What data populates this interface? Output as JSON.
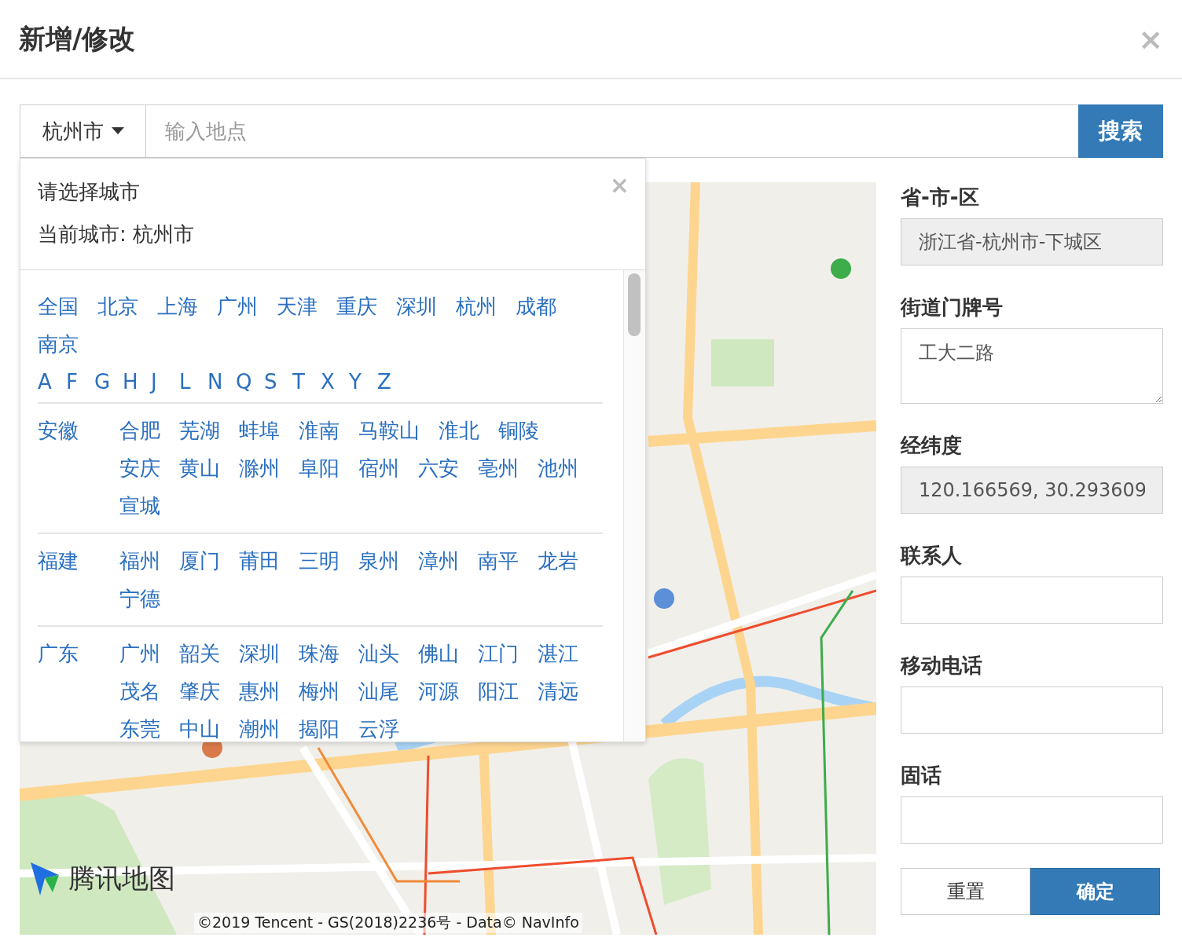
{
  "dialog": {
    "title": "新增/修改",
    "close": "×"
  },
  "search": {
    "city": "杭州市",
    "placeholder": "输入地点",
    "button": "搜索"
  },
  "city_picker": {
    "title": "请选择城市",
    "close": "×",
    "current": "当前城市: 杭州市",
    "hot_cities": [
      "全国",
      "北京",
      "上海",
      "广州",
      "天津",
      "重庆",
      "深圳",
      "杭州",
      "成都",
      "南京"
    ],
    "letters": [
      "A",
      "F",
      "G",
      "H",
      "J",
      "L",
      "N",
      "Q",
      "S",
      "T",
      "X",
      "Y",
      "Z"
    ],
    "provinces": [
      {
        "name": "安徽",
        "cities": [
          "合肥",
          "芜湖",
          "蚌埠",
          "淮南",
          "马鞍山",
          "淮北",
          "铜陵",
          "安庆",
          "黄山",
          "滁州",
          "阜阳",
          "宿州",
          "六安",
          "亳州",
          "池州",
          "宣城"
        ]
      },
      {
        "name": "福建",
        "cities": [
          "福州",
          "厦门",
          "莆田",
          "三明",
          "泉州",
          "漳州",
          "南平",
          "龙岩",
          "宁德"
        ]
      },
      {
        "name": "广东",
        "cities": [
          "广州",
          "韶关",
          "深圳",
          "珠海",
          "汕头",
          "佛山",
          "江门",
          "湛江",
          "茂名",
          "肇庆",
          "惠州",
          "梅州",
          "汕尾",
          "河源",
          "阳江",
          "清远",
          "东莞",
          "中山",
          "潮州",
          "揭阳",
          "云浮"
        ]
      }
    ]
  },
  "map": {
    "kind": "picture",
    "logo": "腾讯地图",
    "copyright": "©2019 Tencent - GS(2018)2236号 - Data© NavInfo"
  },
  "form": {
    "fields": [
      {
        "label": "省-市-区",
        "kind": "input",
        "disabled": true,
        "value": "浙江省-杭州市-下城区"
      },
      {
        "label": "街道门牌号",
        "kind": "textarea",
        "disabled": false,
        "value": "工大二路"
      },
      {
        "label": "经纬度",
        "kind": "input",
        "disabled": true,
        "value": "120.166569, 30.293609"
      },
      {
        "label": "联系人",
        "kind": "input",
        "disabled": false
      },
      {
        "label": "移动电话",
        "kind": "input",
        "disabled": false
      },
      {
        "label": "固话",
        "kind": "input",
        "disabled": false
      }
    ],
    "buttons": [
      {
        "label": "重置",
        "primary": false
      },
      {
        "label": "确定",
        "primary": true
      }
    ]
  }
}
